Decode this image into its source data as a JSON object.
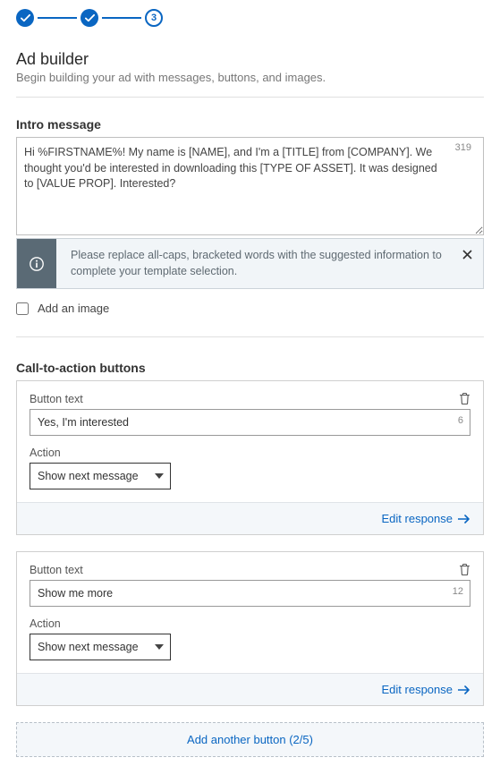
{
  "stepper": {
    "current_number": "3"
  },
  "header": {
    "title": "Ad builder",
    "subtitle": "Begin building your ad with messages, buttons, and images."
  },
  "intro": {
    "label": "Intro message",
    "value": "Hi %FIRSTNAME%! My name is [NAME], and I'm a [TITLE] from [COMPANY]. We thought you'd be interested in downloading this [TYPE OF ASSET]. It was designed to [VALUE PROP]. Interested?",
    "char_count": "319"
  },
  "info_banner": {
    "text": "Please replace all-caps, bracketed words with the suggested information to complete your template selection."
  },
  "add_image": {
    "label": "Add an image"
  },
  "cta": {
    "section_label": "Call-to-action buttons",
    "field_button_text": "Button text",
    "field_action": "Action",
    "edit_response": "Edit response",
    "add_another": "Add another button (2/5)",
    "buttons": [
      {
        "text": "Yes, I'm interested",
        "count": "6",
        "action": "Show next message"
      },
      {
        "text": "Show me more",
        "count": "12",
        "action": "Show next message"
      }
    ]
  }
}
